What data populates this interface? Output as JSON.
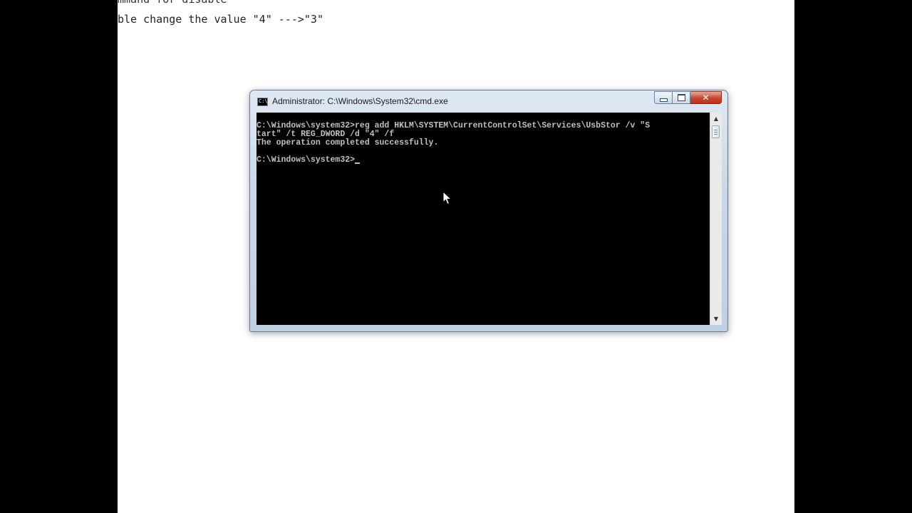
{
  "document": {
    "lines": [
      "mmand for disable",
      "ble change the value \"4\" --->\"3\""
    ]
  },
  "cmd_window": {
    "title": "Administrator: C:\\Windows\\System32\\cmd.exe",
    "icon": "cmd-app-icon",
    "icon_text": "C:\\",
    "controls": {
      "minimize": "minimize-icon",
      "maximize": "maximize-icon",
      "close_label": "✕"
    },
    "console_lines": [
      "C:\\Windows\\system32>reg add HKLM\\SYSTEM\\CurrentControlSet\\Services\\UsbStor /v \"S",
      "tart\" /t REG_DWORD /d \"4\" /f",
      "The operation completed successfully.",
      "",
      "C:\\Windows\\system32>"
    ],
    "scrollbar": {
      "up_arrow": "▲",
      "down_arrow": "▼"
    }
  },
  "colors": {
    "console_bg": "#000000",
    "console_text": "#c0c0c0",
    "close_button": "#c8462e"
  }
}
